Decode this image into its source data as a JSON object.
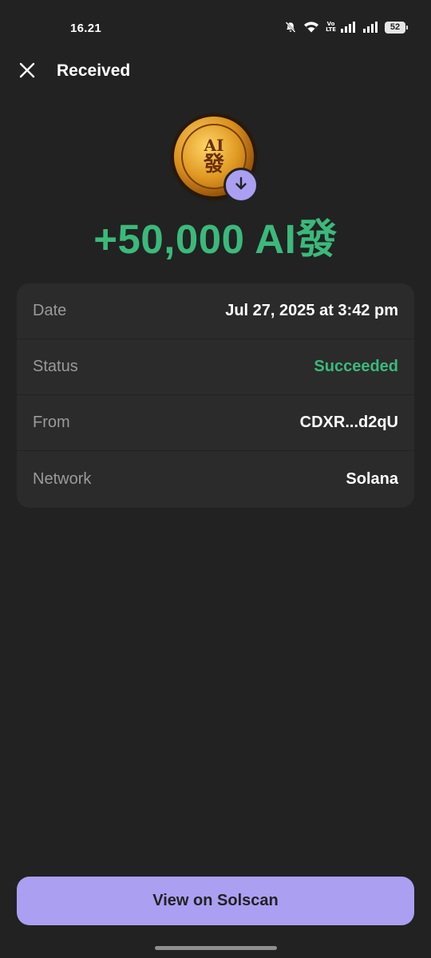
{
  "status_bar": {
    "time": "16.21",
    "network_label_top": "Vo",
    "network_label_bottom": "LTE",
    "battery": "52"
  },
  "header": {
    "title": "Received",
    "close_icon": "close-icon"
  },
  "token": {
    "icon": "ai-coin-icon",
    "badge_icon": "arrow-down-icon",
    "coin_text_top": "AI",
    "coin_text_bottom": "發"
  },
  "amount": "+50,000 AI發",
  "details": [
    {
      "label": "Date",
      "value": "Jul 27, 2025 at 3:42 pm"
    },
    {
      "label": "Status",
      "value": "Succeeded"
    },
    {
      "label": "From",
      "value": "CDXR...d2qU"
    },
    {
      "label": "Network",
      "value": "Solana"
    }
  ],
  "button": {
    "label": "View on Solscan"
  },
  "colors": {
    "background": "#222222",
    "card": "#2b2b2b",
    "success": "#3bb97b",
    "accent": "#ab9ff2"
  }
}
